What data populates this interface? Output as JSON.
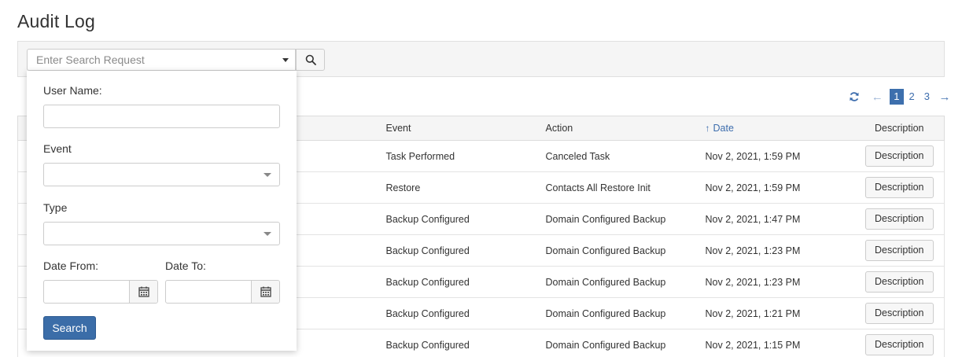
{
  "page": {
    "title": "Audit Log"
  },
  "search": {
    "placeholder": "Enter Search Request"
  },
  "pagination": {
    "pages": [
      "1",
      "2",
      "3"
    ],
    "active_page": "1",
    "prev": "←",
    "next": "→"
  },
  "table": {
    "columns": [
      "",
      "Event",
      "Action",
      "Date",
      "Description"
    ],
    "sort_arrow": "↑",
    "rows": [
      {
        "event": "Task Performed",
        "action": "Canceled Task",
        "date": "Nov 2, 2021, 1:59 PM",
        "button": "Description"
      },
      {
        "event": "Restore",
        "action": "Contacts All Restore Init",
        "date": "Nov 2, 2021, 1:59 PM",
        "button": "Description"
      },
      {
        "event": "Backup Configured",
        "action": "Domain Configured Backup",
        "date": "Nov 2, 2021, 1:47 PM",
        "button": "Description"
      },
      {
        "event": "Backup Configured",
        "action": "Domain Configured Backup",
        "date": "Nov 2, 2021, 1:23 PM",
        "button": "Description"
      },
      {
        "event": "Backup Configured",
        "action": "Domain Configured Backup",
        "date": "Nov 2, 2021, 1:23 PM",
        "button": "Description"
      },
      {
        "event": "Backup Configured",
        "action": "Domain Configured Backup",
        "date": "Nov 2, 2021, 1:21 PM",
        "button": "Description"
      },
      {
        "event": "Backup Configured",
        "action": "Domain Configured Backup",
        "date": "Nov 2, 2021, 1:15 PM",
        "button": "Description"
      }
    ]
  },
  "filter": {
    "user_name_label": "User Name:",
    "user_name_value": "",
    "event_label": "Event",
    "event_value": "",
    "type_label": "Type",
    "type_value": "",
    "date_from_label": "Date From:",
    "date_from_value": "",
    "date_to_label": "Date To:",
    "date_to_value": "",
    "search_label": "Search"
  },
  "icons": {
    "search": "search-icon",
    "refresh": "refresh-icon",
    "calendar": "calendar-icon",
    "dropdown": "caret-down-icon"
  },
  "colors": {
    "accent": "#3d6dad",
    "primary_button": "#3b6da8"
  }
}
